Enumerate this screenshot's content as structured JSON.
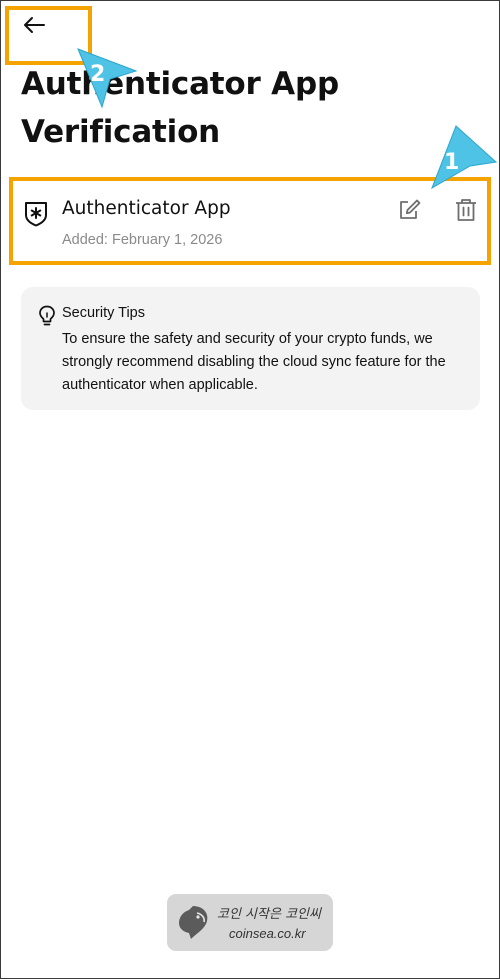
{
  "header": {
    "back_icon": "arrow-left-icon",
    "title": "Authenticator App Verification"
  },
  "authenticator": {
    "icon": "shield-asterisk-icon",
    "name": "Authenticator App",
    "added": "Added: February 1, 2026",
    "edit_icon": "edit-icon",
    "delete_icon": "trash-icon"
  },
  "security_tips": {
    "icon": "lightbulb-icon",
    "title": "Security Tips",
    "body": "To ensure the safety and security of your crypto funds, we strongly recommend disabling the cloud sync feature for the authenticator when applicable."
  },
  "annotations": {
    "markers": [
      "1",
      "2"
    ],
    "highlight_color": "#f5a300",
    "arrow_color": "#4ec3e6"
  },
  "watermark": {
    "line1": "코인 시작은 코인씨",
    "line2": "coinsea.co.kr"
  }
}
